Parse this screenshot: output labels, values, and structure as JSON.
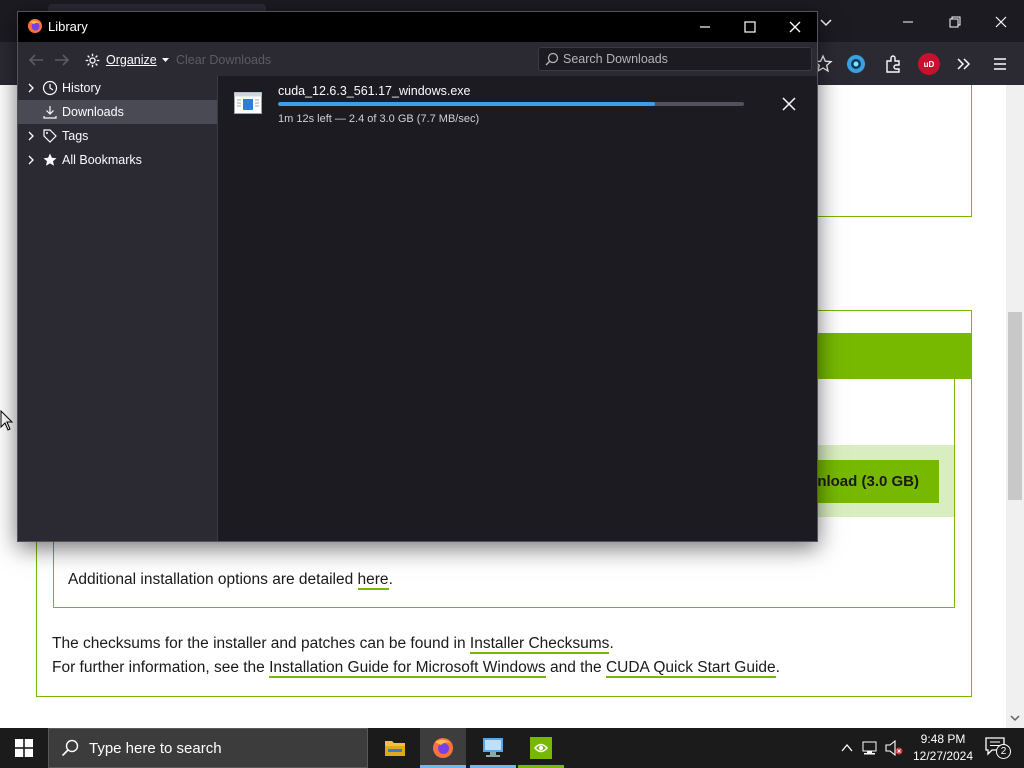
{
  "library": {
    "title": "Library",
    "toolbar": {
      "organize_label": "Organize",
      "clear_downloads_label": "Clear Downloads",
      "search_placeholder": "Search Downloads"
    },
    "sidebar": {
      "items": [
        {
          "label": "History",
          "icon": "clock-icon",
          "expandable": true
        },
        {
          "label": "Downloads",
          "icon": "download-icon",
          "expandable": false,
          "selected": true
        },
        {
          "label": "Tags",
          "icon": "tag-icon",
          "expandable": true
        },
        {
          "label": "All Bookmarks",
          "icon": "star-icon",
          "expandable": true
        }
      ]
    },
    "download": {
      "filename": "cuda_12.6.3_561.17_windows.exe",
      "status": "1m 12s left — 2.4 of 3.0 GB (7.7 MB/sec)",
      "progress_fraction": 0.81
    }
  },
  "page": {
    "download_button_label": "nload (3.0 GB)",
    "install_options_prefix": "Additional installation options are detailed ",
    "install_options_link": "here",
    "install_options_suffix": ".",
    "checksums_prefix": "The checksums for the installer and patches can be found in ",
    "checksums_link": "Installer Checksums",
    "checksums_suffix": ".",
    "info_prefix": "For further information, see the ",
    "info_link_guide": "Installation Guide for Microsoft Windows",
    "info_middle": " and the ",
    "info_link_quickstart": "CUDA Quick Start Guide",
    "info_suffix": ".",
    "accent_color": "#76b900"
  },
  "browser_toolbar": {
    "extension_badge": "uD"
  },
  "taskbar": {
    "search_placeholder": "Type here to search",
    "time": "9:48 PM",
    "date": "12/27/2024",
    "notification_count": "2"
  }
}
